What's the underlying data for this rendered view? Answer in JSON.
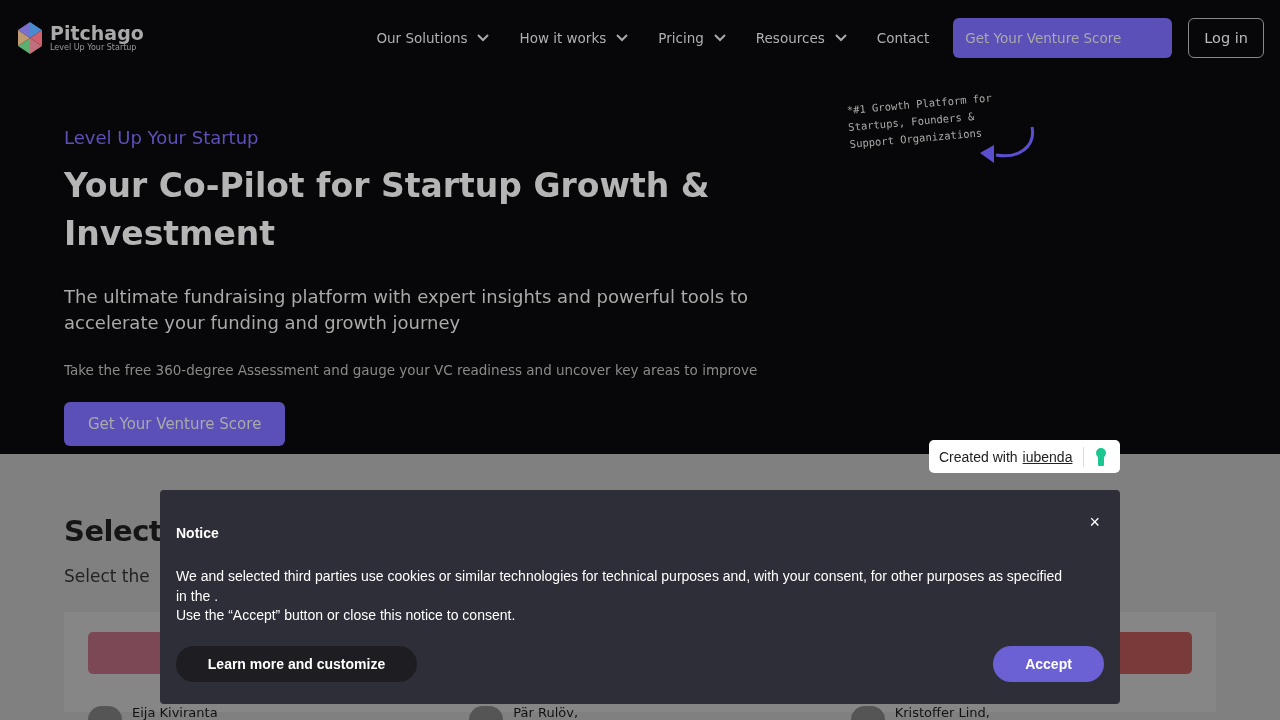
{
  "nav": {
    "logo": {
      "name": "Pitchago",
      "tagline": "Level Up Your Startup"
    },
    "items": [
      {
        "label": "Our Solutions",
        "dropdown": true
      },
      {
        "label": "How it works",
        "dropdown": true
      },
      {
        "label": "Pricing",
        "dropdown": true
      },
      {
        "label": "Resources",
        "dropdown": true
      },
      {
        "label": "Contact",
        "dropdown": false
      }
    ],
    "cta": "Get Your Venture Score",
    "login": "Log in"
  },
  "hero": {
    "eyebrow": "Level Up Your Startup",
    "title": "Your Co-Pilot for Startup Growth & Investment",
    "subtitle": "The ultimate fundraising platform with expert insights and powerful tools to accelerate your funding and growth journey",
    "note": "Take the free 360-degree Assessment and gauge your VC readiness and uncover key areas to improve",
    "button": "Get Your Venture Score",
    "annotation": "*#1 Growth Platform for Startups, Founders & Support Organizations"
  },
  "section": {
    "heading": "Select",
    "subheading": "Select the",
    "cards": [
      {
        "color": "#7c4856",
        "name": "Eija Kiviranta"
      },
      {
        "name": "Pär Rulöv,"
      },
      {
        "color": "#7b3a3a",
        "name": "Kristoffer Lind,"
      }
    ]
  },
  "badge": {
    "text": "Created with",
    "link": "iubenda"
  },
  "notice": {
    "title": "Notice",
    "paragraphs": [
      "We and selected third parties use cookies or similar technologies for technical purposes and, with your consent, for other purposes as specified in the .",
      "Use the “Accept” button or close this notice to consent."
    ],
    "close": "×",
    "learn_more": "Learn more and customize",
    "accept": "Accept"
  }
}
